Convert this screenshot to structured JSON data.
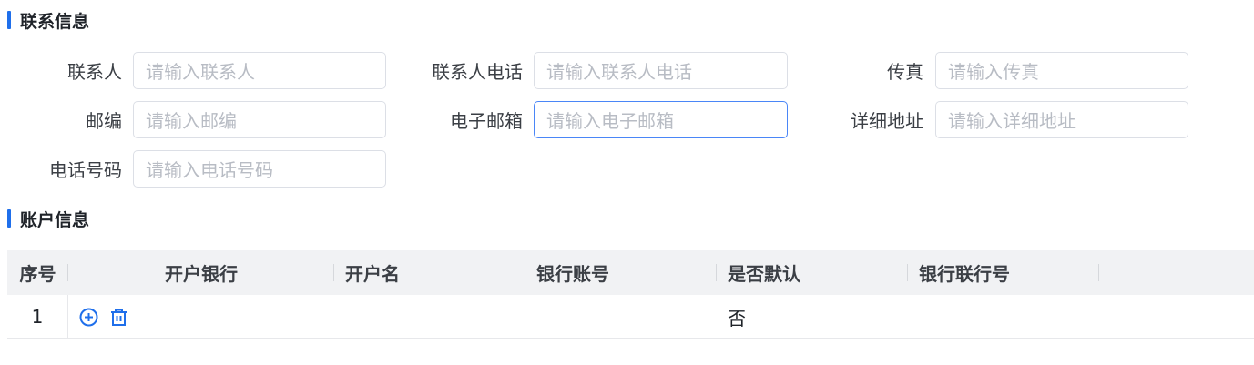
{
  "contact_section": {
    "title": "联系信息",
    "fields": [
      {
        "key": "contact",
        "label": "联系人",
        "placeholder": "请输入联系人"
      },
      {
        "key": "contact_phone",
        "label": "联系人电话",
        "placeholder": "请输入联系人电话"
      },
      {
        "key": "fax",
        "label": "传真",
        "placeholder": "请输入传真"
      },
      {
        "key": "postcode",
        "label": "邮编",
        "placeholder": "请输入邮编"
      },
      {
        "key": "email",
        "label": "电子邮箱",
        "placeholder": "请输入电子邮箱"
      },
      {
        "key": "address",
        "label": "详细地址",
        "placeholder": "请输入详细地址"
      },
      {
        "key": "phone",
        "label": "电话号码",
        "placeholder": "请输入电话号码"
      }
    ]
  },
  "account_section": {
    "title": "账户信息",
    "columns": [
      "序号",
      "开户银行",
      "开户名",
      "银行账号",
      "是否默认",
      "银行联行号"
    ],
    "rows": [
      {
        "index": "1",
        "bank": "",
        "account_name": "",
        "account_no": "",
        "is_default": "否",
        "branch_no": ""
      }
    ],
    "row_actions": [
      "add-circle-icon",
      "trash-icon"
    ]
  },
  "colors": {
    "accent": "#1f6feb",
    "focus_border": "#4a86f7",
    "header_bg": "#f1f2f4"
  }
}
